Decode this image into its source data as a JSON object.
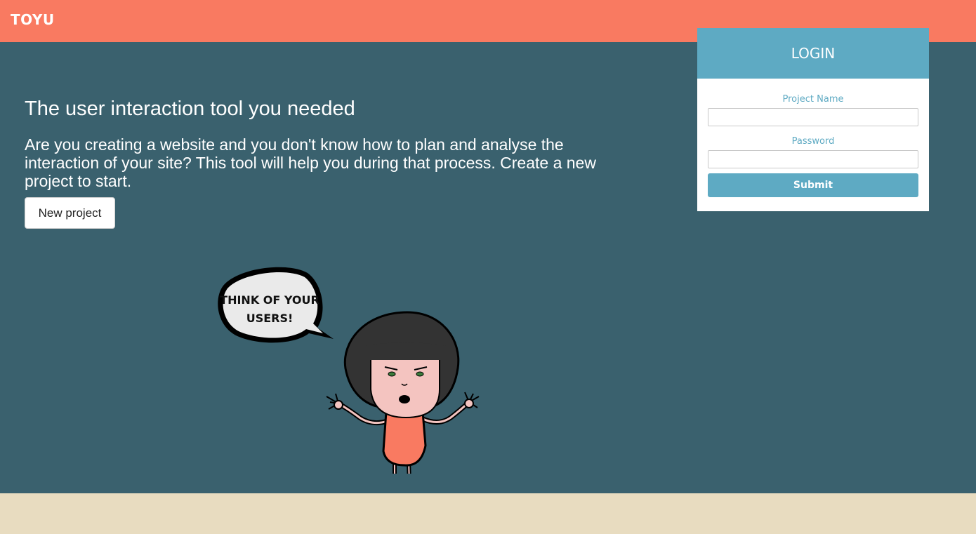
{
  "header": {
    "brand": "TOYU"
  },
  "hero": {
    "title": "The user interaction tool you needed",
    "text": "Are you creating a website and you don't know how to plan and analyse the interaction of your site? This tool will help you during that process. Create a new project to start.",
    "new_project_label": "New project"
  },
  "illustration": {
    "speech_line1": "THINK OF YOUR",
    "speech_line2": "USERS!"
  },
  "login": {
    "title": "LOGIN",
    "project_name_label": "Project Name",
    "project_name_value": "",
    "password_label": "Password",
    "password_value": "",
    "submit_label": "Submit"
  },
  "colors": {
    "header_bg": "#f97a61",
    "hero_bg": "#3a616e",
    "accent": "#5eaac3",
    "footer_bg": "#e8dcc0"
  }
}
